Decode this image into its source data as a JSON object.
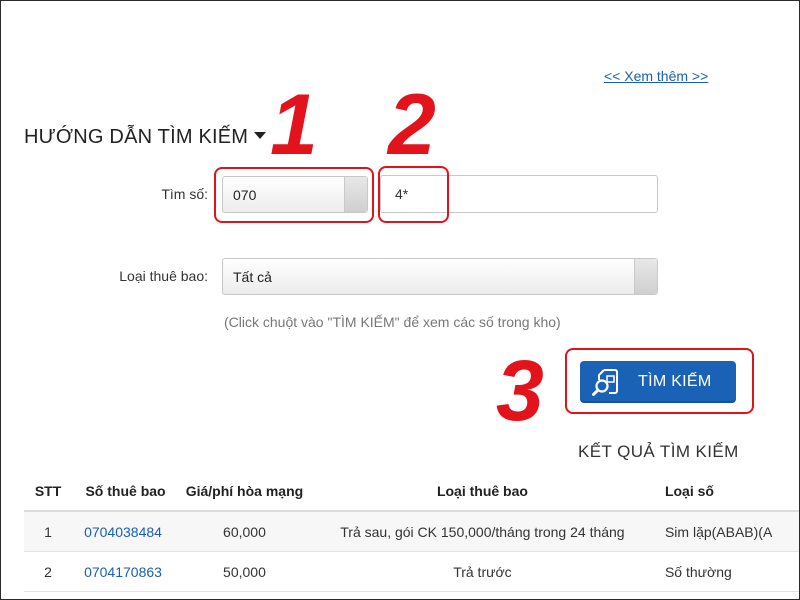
{
  "header": {
    "see_more": "<< Xem thêm >>",
    "guide_title": "HƯỚNG DẪN TÌM KIẾM"
  },
  "form": {
    "search_label": "Tìm số:",
    "prefix_value": "070",
    "number_value": "4*",
    "subscriber_type_label": "Loại thuê bao:",
    "subscriber_type_value": "Tất cả",
    "hint": "(Click chuột vào \"TÌM KIẾM\" để xem các số trong kho)",
    "search_button": "TÌM KIẾM"
  },
  "annotations": [
    "1",
    "2",
    "3"
  ],
  "results": {
    "title": "KẾT QUẢ TÌM KIẾM",
    "columns": [
      "STT",
      "Số thuê bao",
      "Giá/phí hòa mạng",
      "Loại thuê bao",
      "Loại số"
    ],
    "rows": [
      [
        "1",
        "0704038484",
        "60,000",
        "Trả sau, gói CK 150,000/tháng trong 24 tháng",
        "Sim lặp(ABAB)(A"
      ],
      [
        "2",
        "0704170863",
        "50,000",
        "Trả trước",
        "Số thường"
      ]
    ]
  },
  "colors": {
    "annotation_red": "#e3131b",
    "button_blue": "#1a62b5",
    "link_blue": "#1a5fb4"
  },
  "icons": [
    "caret-down-icon",
    "sim-search-icon"
  ]
}
